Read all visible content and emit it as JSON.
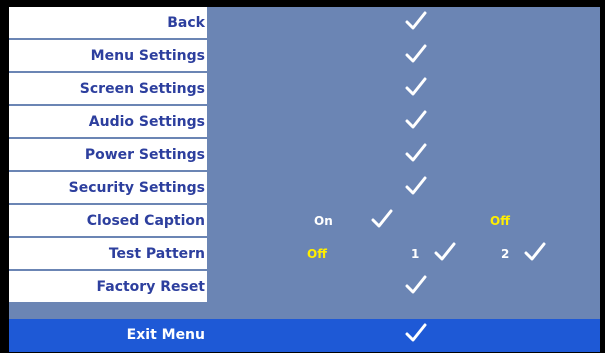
{
  "menu": {
    "items": [
      {
        "label": "Back"
      },
      {
        "label": "Menu Settings"
      },
      {
        "label": "Screen Settings"
      },
      {
        "label": "Audio Settings"
      },
      {
        "label": "Power Settings"
      },
      {
        "label": "Security Settings"
      },
      {
        "label": "Closed Caption",
        "options": [
          "On",
          "Off"
        ]
      },
      {
        "label": "Test Pattern",
        "options": [
          "Off",
          "1",
          "2"
        ]
      },
      {
        "label": "Factory Reset"
      },
      {
        "label": "Exit Menu"
      }
    ],
    "selected_item": "Exit Menu"
  },
  "colors": {
    "panel": "#6b85b4",
    "label_text": "#2d3f9e",
    "highlight": "#1e59d6",
    "option_active": "#ffee00",
    "option_inactive": "#ffffff"
  },
  "icons": {
    "check": "checkmark-icon"
  }
}
